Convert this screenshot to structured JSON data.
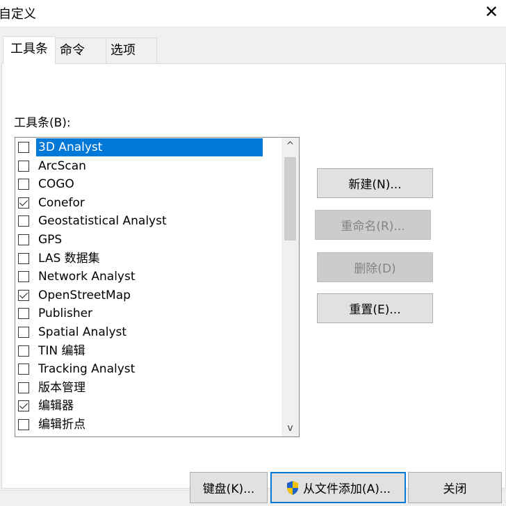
{
  "window": {
    "title": "自定义",
    "close_glyph": "✕"
  },
  "tabs": [
    {
      "label": "工具条",
      "active": true
    },
    {
      "label": "命令",
      "active": false
    },
    {
      "label": "选项",
      "active": false
    }
  ],
  "toolbars": {
    "label": "工具条(B):",
    "items": [
      {
        "label": "3D Analyst",
        "checked": false,
        "selected": true
      },
      {
        "label": "ArcScan",
        "checked": false
      },
      {
        "label": "COGO",
        "checked": false
      },
      {
        "label": "Conefor",
        "checked": true
      },
      {
        "label": "Geostatistical Analyst",
        "checked": false
      },
      {
        "label": "GPS",
        "checked": false
      },
      {
        "label": "LAS 数据集",
        "checked": false
      },
      {
        "label": "Network Analyst",
        "checked": false
      },
      {
        "label": "OpenStreetMap",
        "checked": true
      },
      {
        "label": "Publisher",
        "checked": false
      },
      {
        "label": "Spatial Analyst",
        "checked": false
      },
      {
        "label": "TIN 编辑",
        "checked": false
      },
      {
        "label": "Tracking Analyst",
        "checked": false
      },
      {
        "label": "版本管理",
        "checked": false
      },
      {
        "label": "编辑器",
        "checked": true
      },
      {
        "label": "编辑折点",
        "checked": false
      }
    ]
  },
  "buttons": {
    "new": "新建(N)...",
    "rename": "重命名(R)...",
    "delete": "删除(D)",
    "reset": "重置(E)...",
    "keyboard": "键盘(K)...",
    "add_from_file": "从文件添加(A)...",
    "close": "关闭"
  },
  "scroll": {
    "up_glyph": "^",
    "down_glyph": "v"
  },
  "icons": {
    "shield": "shield-icon",
    "checkbox_checked": "checkmark-icon",
    "close": "close-icon"
  },
  "colors": {
    "selection": "#0078d7",
    "default_button_border": "#0078d7",
    "shield_blue": "#1e63c8",
    "shield_yellow": "#f2c200"
  }
}
